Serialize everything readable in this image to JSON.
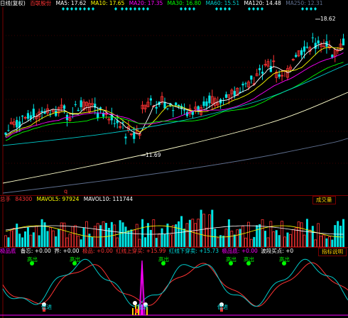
{
  "main_header": {
    "title": "日线(复权)",
    "indicator_name": "百联股份",
    "ma": [
      {
        "label": "MA5: 17.62",
        "color": "#ffffff"
      },
      {
        "label": "MA10: 17.65",
        "color": "#ffff00"
      },
      {
        "label": "MA20: 17.35",
        "color": "#ff00ff"
      },
      {
        "label": "MA30: 16.80",
        "color": "#00ff00"
      },
      {
        "label": "MA60: 15.51",
        "color": "#00cccc"
      },
      {
        "label": "MA120: 14.48",
        "color": "#ffffff"
      },
      {
        "label": "MA250: 12.31",
        "color": "#5f6f8f"
      }
    ]
  },
  "price_annotations": {
    "high": "18.62",
    "low": "11.69"
  },
  "marker": "q",
  "volume_header": {
    "total": "总手",
    "total_value": "84300",
    "mavol5": "MAVOL5: 97924",
    "mavol10": "MAVOL10: 111744",
    "button": "成交量"
  },
  "indicator_header": {
    "name": "极品底",
    "items": [
      {
        "label": "备忘: +0.00",
        "color": "#ffffff"
      },
      {
        "label": "界: +0.00",
        "color": "#ffffff"
      },
      {
        "label": "极品: +0.00",
        "color": "#ff3333"
      },
      {
        "label": "红线上穿买: +15.99",
        "color": "#ff3333"
      },
      {
        "label": "红线下穿卖: +15.73",
        "color": "#00dddd"
      },
      {
        "label": "极品底: +0.00",
        "color": "#ff00ff"
      },
      {
        "label": "波段买点: +0",
        "color": "#ffffff"
      }
    ],
    "button": "指标说明"
  },
  "signals": {
    "sell": "高出",
    "buy": "低进"
  },
  "colors": {
    "up": "#ff3333",
    "down": "#00e5e5",
    "grid": "#7a0000",
    "label_yellow": "#ffcc00"
  }
}
